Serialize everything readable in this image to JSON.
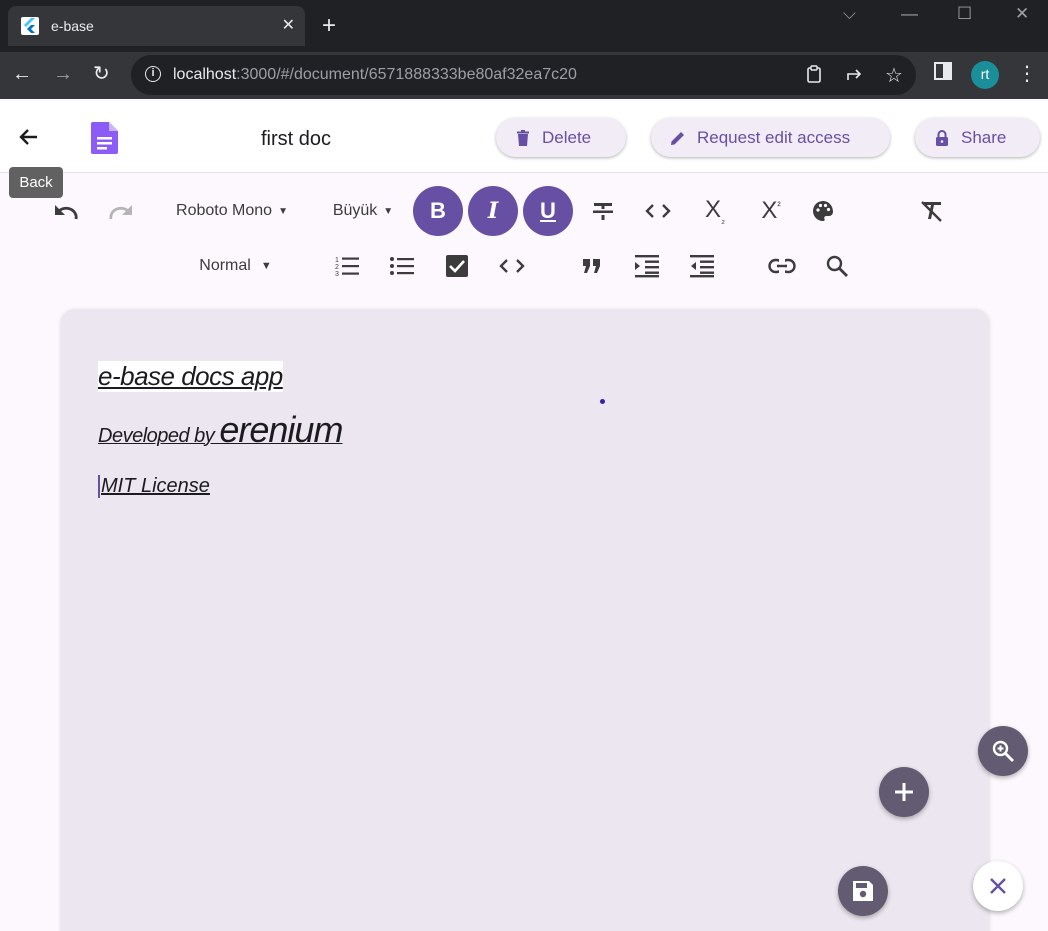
{
  "browser": {
    "tab_title": "e-base",
    "tab_close": "✕",
    "new_tab": "+",
    "url_host": "localhost",
    "url_rest": ":3000/#/document/6571888333be80af32ea7c20",
    "profile_initials": "rt",
    "profile_color": "#1a8f9a"
  },
  "header": {
    "title": "first doc",
    "back_tooltip": "Back",
    "delete_label": "Delete",
    "request_label": "Request edit access",
    "share_label": "Share",
    "accent_color": "#6750a4"
  },
  "editor_toolbar": {
    "font_family": "Roboto Mono",
    "font_size": "Büyük",
    "heading": "Normal",
    "bold": "B",
    "italic": "I",
    "underline": "U"
  },
  "document": {
    "line1": "e-base docs app",
    "line2_prefix": "Developed by ",
    "line2_brand": "erenium",
    "line3": "MIT License"
  }
}
